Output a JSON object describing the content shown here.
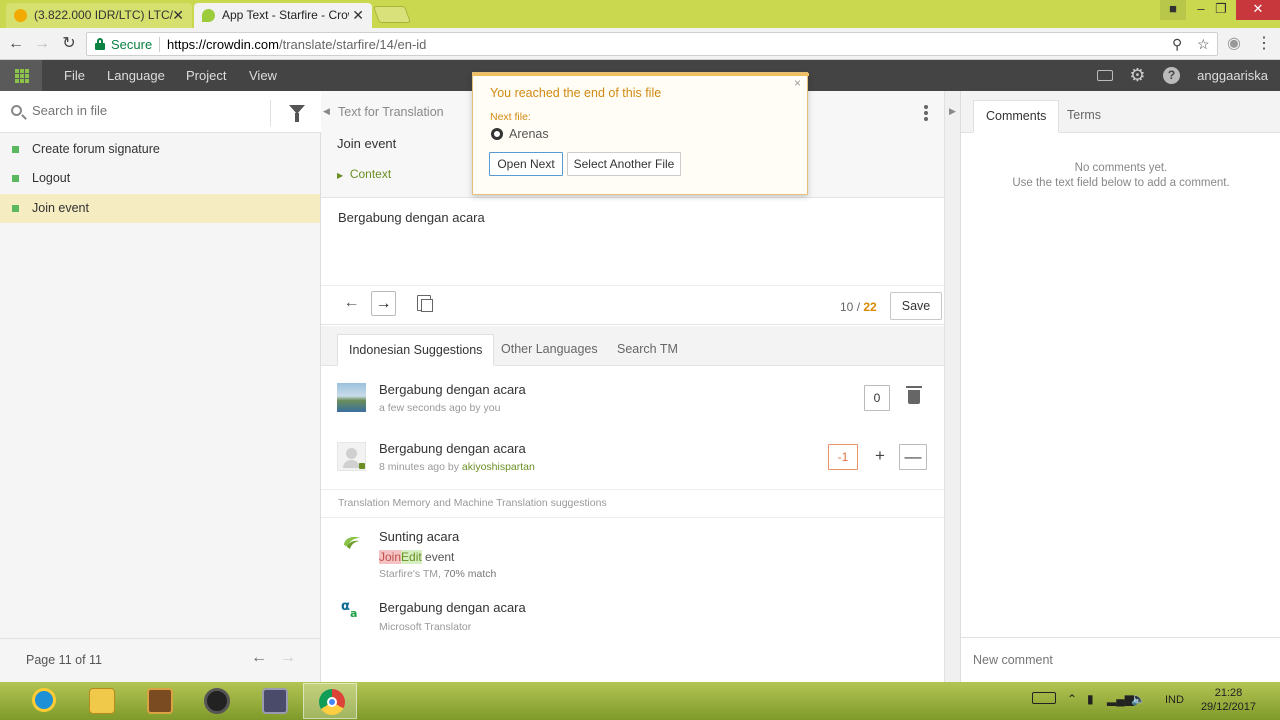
{
  "browser": {
    "tabs": [
      {
        "title": "(3.822.000 IDR/LTC) LTC/",
        "close": "✕"
      },
      {
        "title": "App Text - Starfire - Crow",
        "close": "✕"
      }
    ],
    "secure_label": "Secure",
    "url_scheme_host": "https://crowdin.com",
    "url_path": "/translate/starfire/14/en-id"
  },
  "app": {
    "menu": [
      "File",
      "Language",
      "Project",
      "View"
    ],
    "username": "anggaariska",
    "help_glyph": "?"
  },
  "left_panel": {
    "search_placeholder": "Search in file",
    "strings": [
      {
        "label": "Create forum signature",
        "selected": false
      },
      {
        "label": "Logout",
        "selected": false
      },
      {
        "label": "Join event",
        "selected": true
      }
    ],
    "page_text": "Page 11 of 11"
  },
  "editor": {
    "source_label": "Text for Translation",
    "source_text": "Join event",
    "context_label": "Context",
    "translation": "Bergabung dengan acara",
    "counter_current": "10",
    "counter_sep": " / ",
    "counter_total": "22",
    "save_label": "Save",
    "tabs": [
      "Indonesian Suggestions",
      "Other Languages",
      "Search TM"
    ],
    "suggestions": [
      {
        "text": "Bergabung dengan acara",
        "meta": "a few seconds ago by you",
        "user": "",
        "votes": "0"
      },
      {
        "text": "Bergabung dengan acara",
        "meta": "8 minutes ago by ",
        "user": "akiyoshispartan",
        "votes": "-1"
      }
    ],
    "tm_section_label": "Translation Memory and Machine Translation suggestions",
    "tm": [
      {
        "text": "Sunting acara",
        "src_del": "Join",
        "src_ins": "Edit",
        "src_rest": " event",
        "meta_prefix": "Starfire's TM, ",
        "meta_match": "70% match"
      },
      {
        "text": "Bergabung dengan acara",
        "meta": "Microsoft Translator"
      }
    ]
  },
  "right_panel": {
    "tabs": [
      "Comments",
      "Terms"
    ],
    "no_comments_line1": "No comments yet.",
    "no_comments_line2": "Use the text field below to add a comment.",
    "comment_placeholder": "New comment"
  },
  "popup": {
    "title": "You reached the end of this file",
    "next_file_label": "Next file:",
    "next_file_name": "Arenas",
    "open_next_label": "Open Next",
    "select_other_label": "Select Another File",
    "close_glyph": "×"
  },
  "taskbar": {
    "lang": "IND",
    "time": "21:28",
    "date": "29/12/2017"
  },
  "colors": {
    "accent_green": "#5cb85c",
    "selected_row": "#f5ecc2",
    "popup_title": "#d08a12",
    "header_bg": "#444444",
    "tab_strip": "#c9d84f"
  }
}
